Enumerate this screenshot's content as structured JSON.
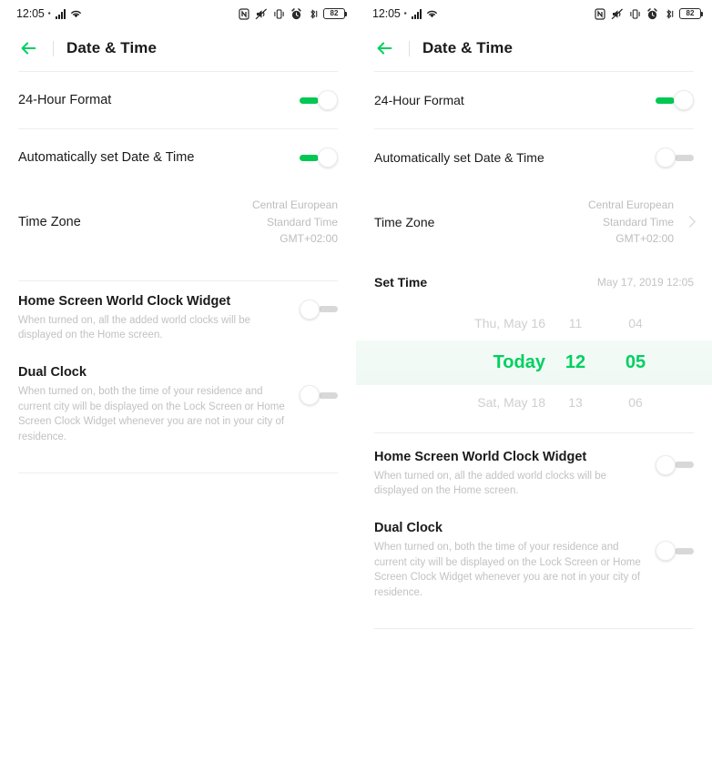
{
  "accent": "#00c853",
  "status_bar": {
    "clock": "12:05",
    "battery_level": "82",
    "icons_left": [
      "signal-bars-icon",
      "wifi-icon"
    ],
    "icons_right": [
      "nfc-icon",
      "mute-icon",
      "vibrate-icon",
      "alarm-icon",
      "bluetooth-icon",
      "battery-icon"
    ]
  },
  "app_bar": {
    "back_icon": "back-arrow-icon",
    "title": "Date & Time"
  },
  "labels": {
    "hour_format": "24-Hour Format",
    "auto_datetime": "Automatically set Date & Time",
    "time_zone": "Time Zone",
    "time_zone_value": [
      "Central European",
      "Standard Time",
      "GMT+02:00"
    ],
    "set_time": "Set Time",
    "set_time_value": "May 17, 2019  12:05",
    "world_clock_title": "Home Screen World Clock Widget",
    "world_clock_desc": "When turned on, all the added world clocks will be displayed on the Home screen.",
    "dual_clock_title": "Dual Clock",
    "dual_clock_desc": "When turned on, both the time of your residence and current city will be displayed on the Lock Screen or Home Screen Clock Widget whenever you are not in your city of residence."
  },
  "left_panel": {
    "hour_format_state": "on",
    "auto_datetime_state": "on",
    "world_clock_state": "off",
    "dual_clock_state": "off"
  },
  "right_panel": {
    "hour_format_state": "on",
    "auto_datetime_state": "off",
    "world_clock_state": "off",
    "dual_clock_state": "off",
    "picker": {
      "prev": {
        "date": "Thu, May 16",
        "hour": "11",
        "minute": "04"
      },
      "selected": {
        "date": "Today",
        "hour": "12",
        "minute": "05"
      },
      "next": {
        "date": "Sat, May 18",
        "hour": "13",
        "minute": "06"
      }
    }
  }
}
